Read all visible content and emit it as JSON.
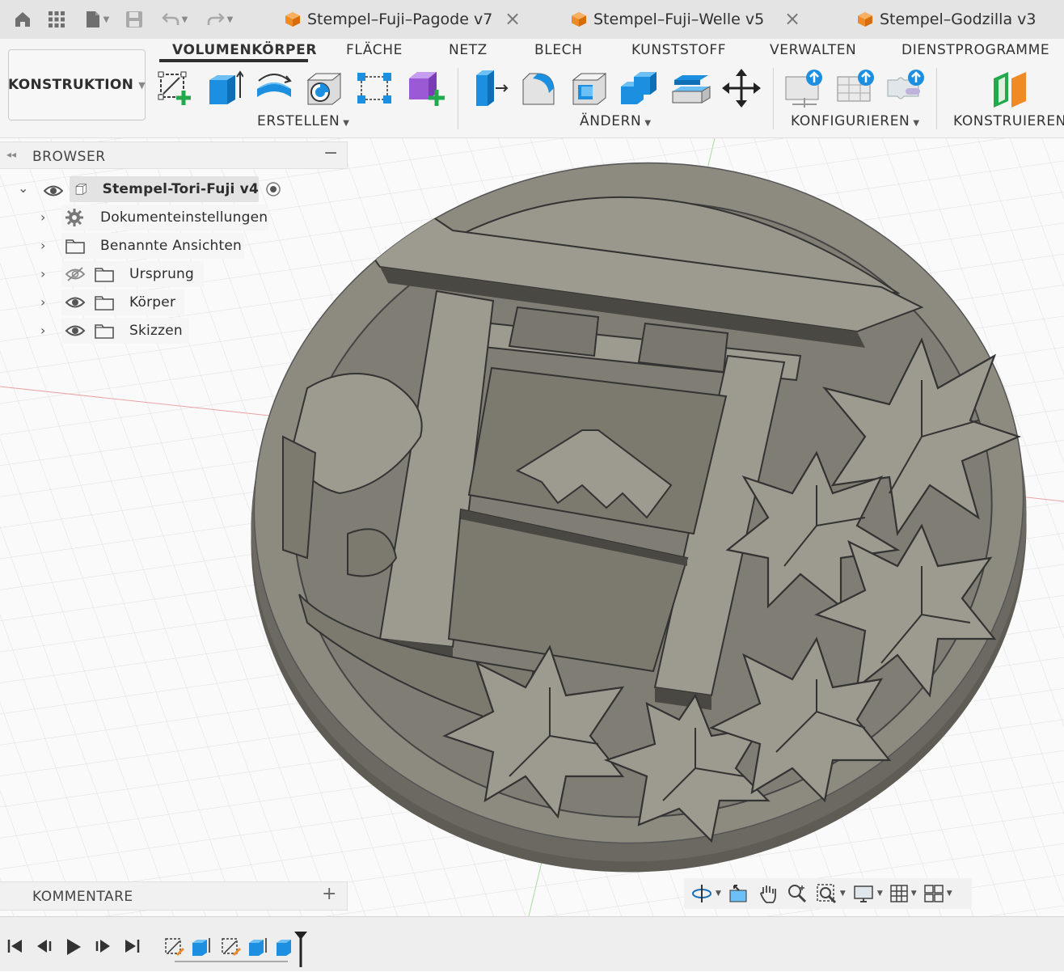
{
  "tabbar": {
    "tabs": [
      {
        "title": "Stempel–Fuji–Pagode v7",
        "icon": "document-cube-icon"
      },
      {
        "title": "Stempel–Fuji–Welle v5",
        "icon": "document-cube-icon"
      },
      {
        "title": "Stempel–Godzilla v3",
        "icon": "document-cube-icon"
      }
    ],
    "close_glyph": "×",
    "quick_access": [
      "home-icon",
      "data-panel-icon",
      "file-menu-icon",
      "save-icon",
      "undo-icon",
      "redo-icon"
    ]
  },
  "ribbon": {
    "workspace_label": "KONSTRUKTION",
    "tabs": [
      "VOLUMENKÖRPER",
      "FLÄCHE",
      "NETZ",
      "BLECH",
      "KUNSTSTOFF",
      "VERWALTEN",
      "DIENSTPROGRAMME"
    ],
    "active_tab": "VOLUMENKÖRPER",
    "groups": {
      "erstellen": "ERSTELLEN",
      "aendern": "ÄNDERN",
      "konfigurieren": "KONFIGURIEREN",
      "konstruieren": "KONSTRUIEREN"
    },
    "colors": {
      "accent_blue": "#1d8fe0",
      "accent_green": "#23a94b",
      "accent_purple": "#9b59d6"
    }
  },
  "browser": {
    "title": "BROWSER",
    "root": "Stempel-Tori-Fuji v4",
    "items": [
      {
        "label": "Dokumenteinstellungen",
        "icon": "gear-icon"
      },
      {
        "label": "Benannte Ansichten",
        "icon": "folder-icon"
      },
      {
        "label": "Ursprung",
        "icon": "folder-icon",
        "visibility": "hidden"
      },
      {
        "label": "Körper",
        "icon": "folder-icon",
        "visibility": "visible"
      },
      {
        "label": "Skizzen",
        "icon": "folder-icon",
        "visibility": "visible"
      }
    ]
  },
  "comments": {
    "title": "KOMMENTARE"
  },
  "navbar": {
    "tools": [
      "orbit-icon",
      "look-at-icon",
      "pan-icon",
      "zoom-icon",
      "fit-icon",
      "display-settings-icon",
      "grid-icon",
      "viewports-icon"
    ]
  },
  "timeline": {
    "controls": [
      "first-icon",
      "previous-icon",
      "play-icon",
      "next-icon",
      "last-icon"
    ],
    "features": [
      "sketch-feature-icon",
      "extrude-feature-icon",
      "sketch-feature-icon",
      "extrude-feature-icon",
      "extrude-feature-icon"
    ]
  }
}
